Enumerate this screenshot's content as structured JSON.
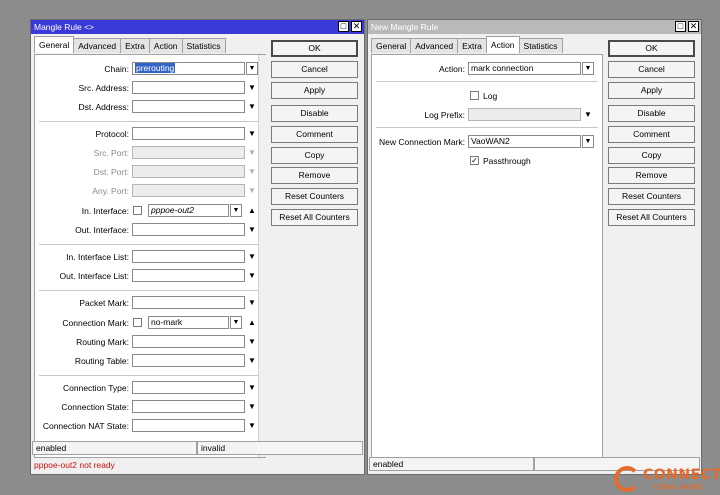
{
  "left_window": {
    "title": "Mangle Rule <>",
    "tabs": [
      "General",
      "Advanced",
      "Extra",
      "Action",
      "Statistics"
    ],
    "fields": {
      "chain": {
        "label": "Chain:",
        "value": "prerouting"
      },
      "src_address": {
        "label": "Src. Address:",
        "value": ""
      },
      "dst_address": {
        "label": "Dst. Address:",
        "value": ""
      },
      "protocol": {
        "label": "Protocol:",
        "value": ""
      },
      "src_port": {
        "label": "Src. Port:",
        "value": ""
      },
      "dst_port": {
        "label": "Dst. Port:",
        "value": ""
      },
      "any_port": {
        "label": "Any. Port:",
        "value": ""
      },
      "in_interface": {
        "label": "In. Interface:",
        "value": "pppoe-out2"
      },
      "out_interface": {
        "label": "Out. Interface:",
        "value": ""
      },
      "in_interface_list": {
        "label": "In. Interface List:",
        "value": ""
      },
      "out_interface_list": {
        "label": "Out. Interface List:",
        "value": ""
      },
      "packet_mark": {
        "label": "Packet Mark:",
        "value": ""
      },
      "connection_mark": {
        "label": "Connection Mark:",
        "value": "no-mark"
      },
      "routing_mark": {
        "label": "Routing Mark:",
        "value": ""
      },
      "routing_table": {
        "label": "Routing Table:",
        "value": ""
      },
      "connection_type": {
        "label": "Connection Type:",
        "value": ""
      },
      "connection_state": {
        "label": "Connection State:",
        "value": ""
      },
      "connection_nat_state": {
        "label": "Connection NAT State:",
        "value": ""
      }
    },
    "buttons": [
      "OK",
      "Cancel",
      "Apply",
      "Disable",
      "Comment",
      "Copy",
      "Remove",
      "Reset Counters",
      "Reset All Counters"
    ],
    "status": {
      "left": "enabled",
      "right": "invalid"
    },
    "error": "pppoe-out2 not ready"
  },
  "right_window": {
    "title": "New Mangle Rule",
    "tabs": [
      "General",
      "Advanced",
      "Extra",
      "Action",
      "Statistics"
    ],
    "fields": {
      "action": {
        "label": "Action:",
        "value": "mark connection"
      },
      "log": {
        "label": "Log",
        "checked": false
      },
      "log_prefix": {
        "label": "Log Prefix:",
        "value": ""
      },
      "new_connection_mark": {
        "label": "New Connection Mark:",
        "value": "VaoWAN2"
      },
      "passthrough": {
        "label": "Passthrough",
        "checked": true
      }
    },
    "buttons": [
      "OK",
      "Cancel",
      "Apply",
      "Disable",
      "Comment",
      "Copy",
      "Remove",
      "Reset Counters",
      "Reset All Counters"
    ],
    "status": {
      "left": "enabled"
    }
  },
  "watermark": {
    "line1": "CONNECT",
    "line2": "CÔNG NGHỆ"
  },
  "colors": {
    "titlebar_active": "#3a3ad8",
    "titlebar_inactive": "#b9b9b9",
    "error": "#d01010",
    "logo": "#e36b2c"
  }
}
